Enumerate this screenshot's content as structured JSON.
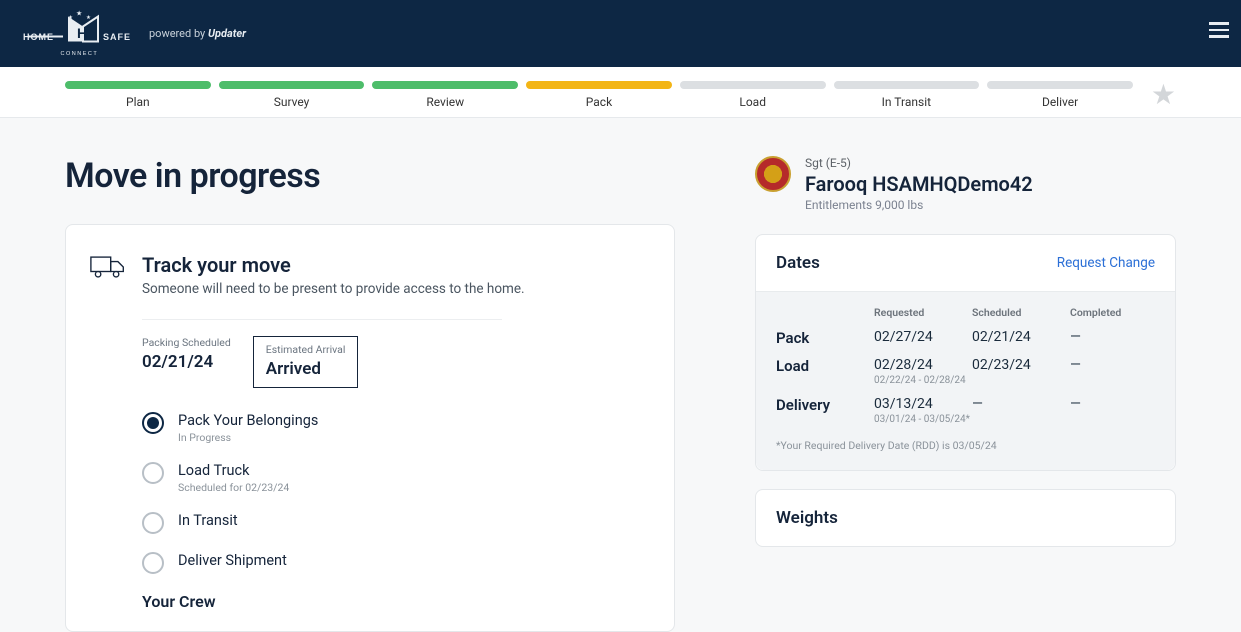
{
  "header": {
    "powered_prefix": "powered by ",
    "powered_brand": "Updater"
  },
  "stepper": {
    "steps": [
      {
        "label": "Plan",
        "state": "done"
      },
      {
        "label": "Survey",
        "state": "done"
      },
      {
        "label": "Review",
        "state": "done"
      },
      {
        "label": "Pack",
        "state": "active"
      },
      {
        "label": "Load",
        "state": "pending"
      },
      {
        "label": "In Transit",
        "state": "pending"
      },
      {
        "label": "Deliver",
        "state": "pending"
      }
    ]
  },
  "page": {
    "title": "Move in progress"
  },
  "track": {
    "heading": "Track your move",
    "sub": "Someone will need to be present to provide access to the home.",
    "packing_label": "Packing Scheduled",
    "packing_value": "02/21/24",
    "arrival_label": "Estimated Arrival",
    "arrival_value": "Arrived",
    "steps": [
      {
        "title": "Pack Your Belongings",
        "sub": "In Progress",
        "on": true
      },
      {
        "title": "Load Truck",
        "sub": "Scheduled for 02/23/24",
        "on": false
      },
      {
        "title": "In Transit",
        "sub": "",
        "on": false
      },
      {
        "title": "Deliver Shipment",
        "sub": "",
        "on": false
      }
    ],
    "crew_heading": "Your Crew"
  },
  "profile": {
    "rank": "Sgt (E-5)",
    "name": "Farooq HSAMHQDemo42",
    "entitlements": "Entitlements 9,000 lbs"
  },
  "dates": {
    "heading": "Dates",
    "link": "Request Change",
    "cols": {
      "requested": "Requested",
      "scheduled": "Scheduled",
      "completed": "Completed"
    },
    "rows": [
      {
        "label": "Pack",
        "requested": "02/27/24",
        "requested_sub": "",
        "scheduled": "02/21/24",
        "completed": "—"
      },
      {
        "label": "Load",
        "requested": "02/28/24",
        "requested_sub": "02/22/24 - 02/28/24",
        "scheduled": "02/23/24",
        "completed": "—"
      },
      {
        "label": "Delivery",
        "requested": "03/13/24",
        "requested_sub": "03/01/24 - 03/05/24*",
        "scheduled": "—",
        "completed": "—"
      }
    ],
    "footnote": "*Your Required Delivery Date (RDD) is 03/05/24"
  },
  "weights": {
    "heading": "Weights"
  }
}
